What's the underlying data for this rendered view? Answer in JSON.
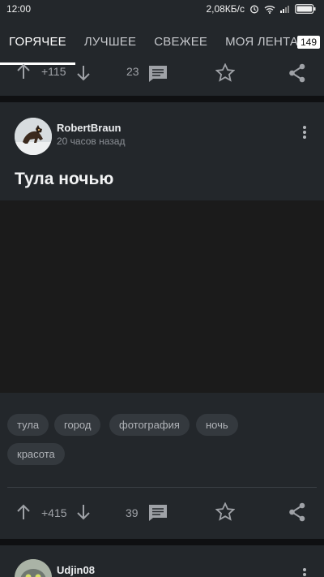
{
  "status_bar": {
    "time": "12:00",
    "network_speed": "2,08КБ/с",
    "icons": [
      "alarm-icon",
      "wifi-icon",
      "signal-icon",
      "battery-icon"
    ]
  },
  "tabs": [
    {
      "label": "ГОРЯЧЕЕ",
      "active": true
    },
    {
      "label": "ЛУЧШЕЕ",
      "active": false
    },
    {
      "label": "СВЕЖЕЕ",
      "active": false
    },
    {
      "label": "МОЯ ЛЕНТА",
      "active": false
    }
  ],
  "feed_badge": "149",
  "previous_post": {
    "rating": "+115",
    "comments": "23"
  },
  "post": {
    "author": "RobertBraun",
    "time": "20 часов назад",
    "title": "Тула ночью",
    "tags": [
      "тула",
      "город",
      "фотография",
      "ночь",
      "красота"
    ],
    "rating": "+415",
    "comments": "39"
  },
  "next_post": {
    "author": "Udjin08"
  },
  "colors": {
    "background": "#181a1d",
    "card": "#23272b",
    "accent": "#ffffff",
    "muted_text": "#a0a3a8"
  }
}
